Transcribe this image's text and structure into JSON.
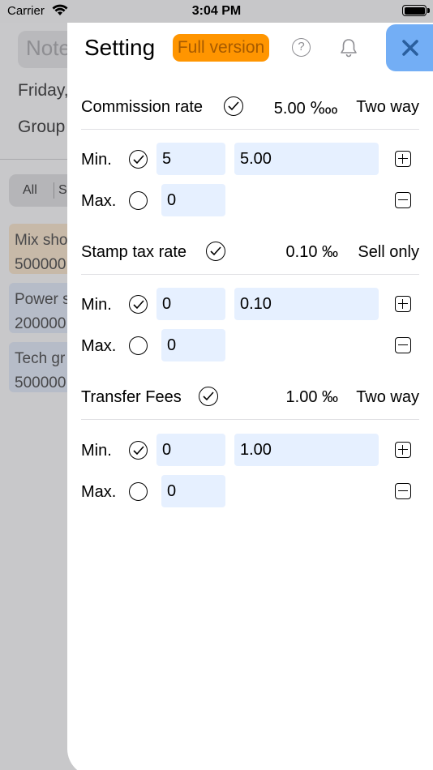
{
  "status_bar": {
    "carrier": "Carrier",
    "time": "3:04 PM"
  },
  "background": {
    "note_label": "Note",
    "date_text": "Friday,",
    "group_text": "Group",
    "segment_all": "All",
    "segment_next": "S",
    "cards": [
      {
        "name": "Mix sho",
        "amount": "500000"
      },
      {
        "name": "Power s",
        "amount": "200000"
      },
      {
        "name": "Tech gr",
        "amount": "500000"
      }
    ]
  },
  "header": {
    "title": "Setting",
    "full_version_label": "Full version",
    "help_symbol": "?",
    "accent_color": "#ff9500",
    "close_color": "#73aef5"
  },
  "sections": [
    {
      "name": "Commission rate",
      "rate": "5.00 ‱",
      "direction": "Two way",
      "min_label": "Min.",
      "min_value": "5",
      "rate_value": "5.00",
      "max_label": "Max.",
      "max_value": "0"
    },
    {
      "name": "Stamp tax rate",
      "rate": "0.10 ‰",
      "direction": "Sell only",
      "min_label": "Min.",
      "min_value": "0",
      "rate_value": "0.10",
      "max_label": "Max.",
      "max_value": "0"
    },
    {
      "name": "Transfer Fees",
      "rate": "1.00 ‰",
      "direction": "Two way",
      "min_label": "Min.",
      "min_value": "0",
      "rate_value": "1.00",
      "max_label": "Max.",
      "max_value": "0"
    }
  ],
  "icons": [
    "wifi-icon",
    "battery-icon",
    "help-icon",
    "bell-icon",
    "close-icon",
    "check-circle-icon",
    "radio-empty-icon",
    "plus-square-icon",
    "minus-square-icon"
  ]
}
